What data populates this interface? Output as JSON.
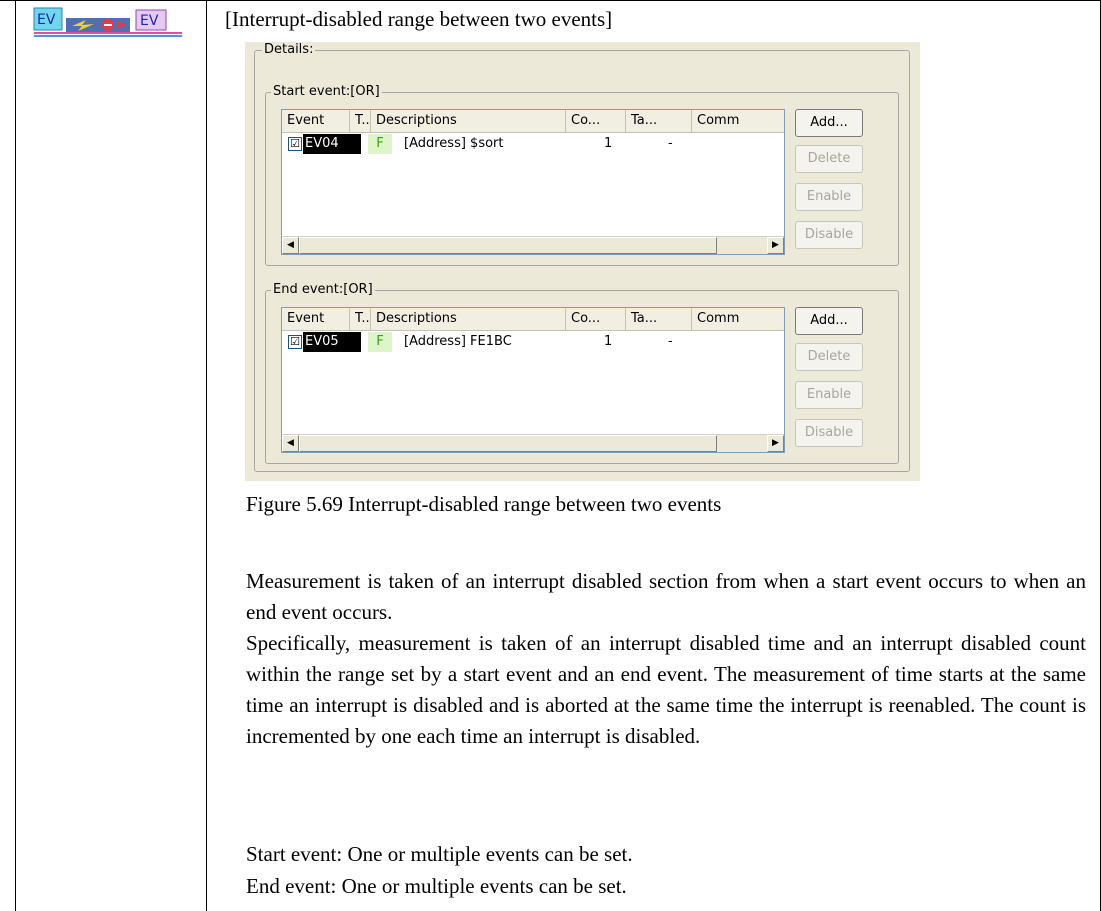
{
  "heading": "[Interrupt-disabled range between two events]",
  "icon": {
    "left_label": "EV",
    "right_label": "EV"
  },
  "dialog": {
    "details_label": "Details:",
    "columns": [
      "Event",
      "T..",
      "Descriptions",
      "Co...",
      "Ta...",
      "Comm"
    ],
    "start_group": {
      "label": "Start event:[OR]",
      "row": {
        "checked": "☑",
        "event": "EV04",
        "type": "F",
        "description": "[Address] $sort",
        "count": "1",
        "task": "-"
      },
      "buttons": {
        "add": "Add...",
        "delete": "Delete",
        "enable": "Enable",
        "disable": "Disable"
      }
    },
    "end_group": {
      "label": "End event:[OR]",
      "row": {
        "checked": "☑",
        "event": "EV05",
        "type": "F",
        "description": "[Address] FE1BC",
        "count": "1",
        "task": "-"
      },
      "buttons": {
        "add": "Add...",
        "delete": "Delete",
        "enable": "Enable",
        "disable": "Disable"
      }
    }
  },
  "caption": "Figure 5.69 Interrupt-disabled range between two events",
  "paragraph1": "Measurement is taken of an interrupt disabled section from when a start event occurs to when an end event occurs.",
  "paragraph2": "Specifically, measurement is taken of an interrupt disabled time and an interrupt disabled count within the range set by a start event and an end event. The measurement of time starts at the same time an interrupt is disabled and is aborted at the same time the interrupt is reenabled. The count is incremented by one each time an interrupt is disabled.",
  "start_note": "Start event: One or multiple events can be set.",
  "end_note": "End event: One or multiple events can be set.",
  "colors": {
    "dialog_bg": "#ece9d8",
    "type_badge": "#ddf5c8",
    "type_text": "#3a9c10"
  }
}
